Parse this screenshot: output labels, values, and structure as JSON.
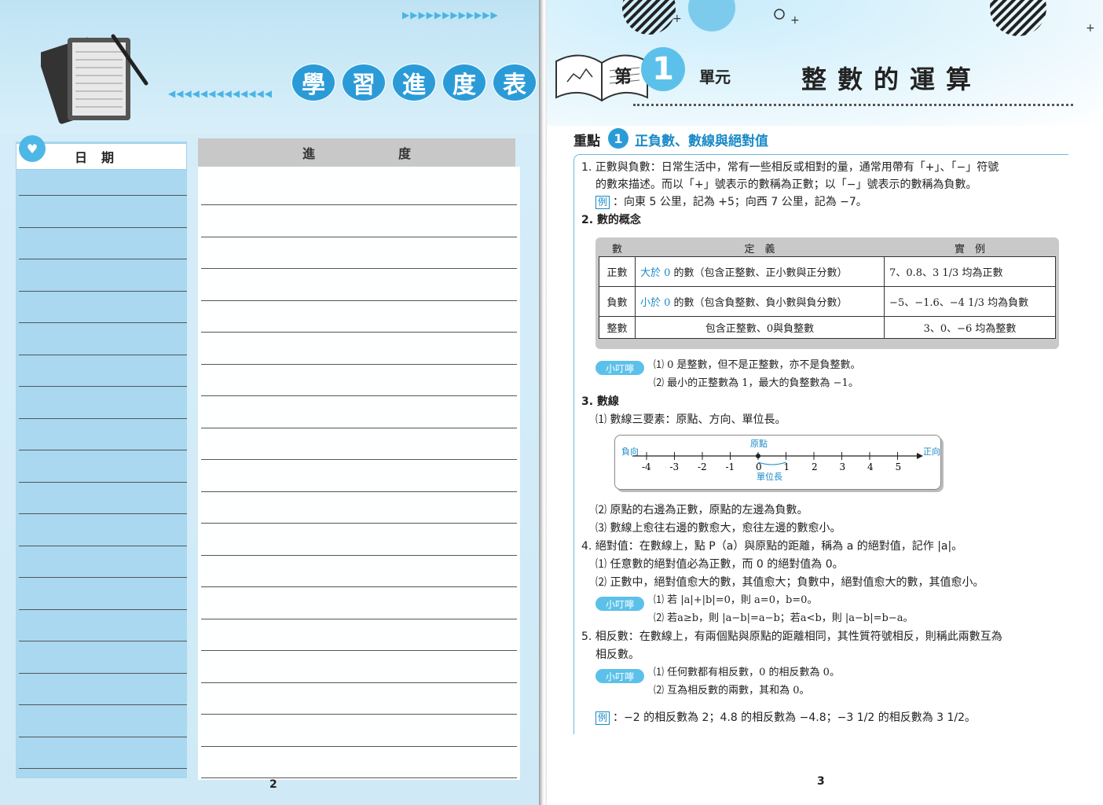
{
  "left": {
    "title_chars": [
      "學",
      "習",
      "進",
      "度",
      "表"
    ],
    "date_header": "日期",
    "progress_header_left": "進",
    "progress_header_right": "度",
    "heart_icon": "♥",
    "page_number": "2"
  },
  "right": {
    "unit_prefix": "第",
    "unit_number": "1",
    "unit_suffix": "單元",
    "unit_title": "整數的運算",
    "focus_label": "重點",
    "focus_number": "1",
    "focus_title": "正負數、數線與絕對值",
    "s1_line1": "1. 正數與負數：日常生活中，常有一些相反或相對的量，通常用帶有「+」、「−」符號",
    "s1_line2": "的數來描述。而以「+」號表示的數稱為正數；以「−」號表示的數稱為負數。",
    "ex_tag": "例",
    "s1_example": "：向東 5 公里，記為 +5；向西 7 公里，記為 −7。",
    "s2_title": "2. 數的概念",
    "table": {
      "headers": [
        "數",
        "定　義",
        "實　例"
      ],
      "rows": [
        {
          "label": "正數",
          "def_blue": "大於 0",
          "def_rest": " 的數（包含正整數、正小數與正分數）",
          "example": "7、0.8、3 1/3 均為正數"
        },
        {
          "label": "負數",
          "def_blue": "小於 0",
          "def_rest": " 的數（包含負整數、負小數與負分數）",
          "example": "−5、−1.6、−4 1/3 均為負數"
        },
        {
          "label": "整數",
          "def_blue": "",
          "def_rest": "包含正整數、0與負整數",
          "example": "3、0、−6 均為整數"
        }
      ]
    },
    "tip_label": "小叮嚀",
    "tip1_1": "⑴ 0 是整數，但不是正整數，亦不是負整數。",
    "tip1_2": "⑵ 最小的正整數為 1，最大的負整數為 −1。",
    "s3_title": "3. 數線",
    "s3_1": "⑴ 數線三要素：原點、方向、單位長。",
    "numline": {
      "neg_label": "負向",
      "pos_label": "正向",
      "origin_label": "原點",
      "unit_label": "單位長",
      "ticks": [
        "-4",
        "-3",
        "-2",
        "-1",
        "0",
        "1",
        "2",
        "3",
        "4",
        "5"
      ]
    },
    "s3_2": "⑵ 原點的右邊為正數，原點的左邊為負數。",
    "s3_3": "⑶ 數線上愈往右邊的數愈大，愈往左邊的數愈小。",
    "s4_1": "4. 絕對值：在數線上，點 P（a）與原點的距離，稱為 a 的絕對值，記作 |a|。",
    "s4_2": "⑴ 任意數的絕對值必為正數，而 0 的絕對值為 0。",
    "s4_3": "⑵ 正數中，絕對值愈大的數，其值愈大；負數中，絕對值愈大的數，其值愈小。",
    "tip2_1": "⑴ 若 |a|+|b|=0，則 a=0，b=0。",
    "tip2_2": "⑵ 若a≥b，則 |a−b|=a−b；若a<b，則 |a−b|=b−a。",
    "s5_1": "5. 相反數：在數線上，有兩個點與原點的距離相同，其性質符號相反，則稱此兩數互為",
    "s5_2": "相反數。",
    "tip3_1": "⑴ 任何數都有相反數，0 的相反數為 0。",
    "tip3_2": "⑵ 互為相反數的兩數，其和為 0。",
    "s5_example": "：−2 的相反數為 2；4.8 的相反數為 −4.8；−3 1/2 的相反數為 3 1/2。",
    "page_number": "3"
  }
}
